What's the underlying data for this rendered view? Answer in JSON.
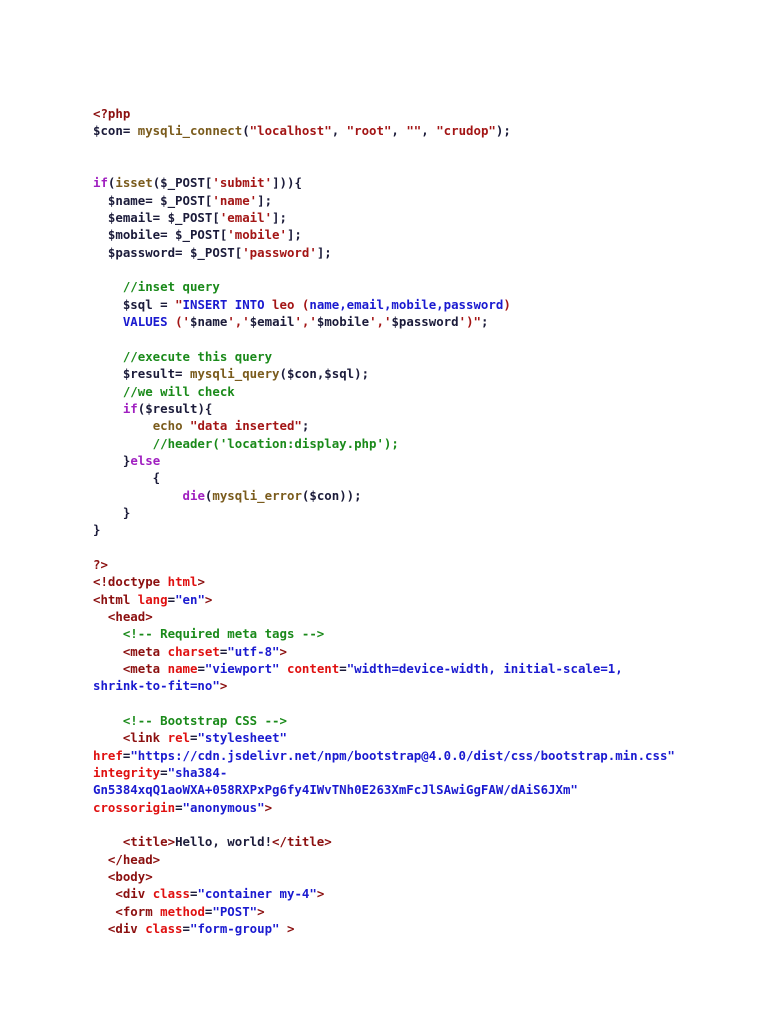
{
  "document": {
    "lines": [
      [
        {
          "text": "<?php",
          "type": "p"
        }
      ],
      [
        {
          "text": "$con= ",
          "type": "d"
        },
        {
          "text": "mysqli_connect",
          "type": "f"
        },
        {
          "text": "(",
          "type": "d"
        },
        {
          "text": "\"localhost\"",
          "type": "s"
        },
        {
          "text": ", ",
          "type": "d"
        },
        {
          "text": "\"root\"",
          "type": "s"
        },
        {
          "text": ", ",
          "type": "d"
        },
        {
          "text": "\"\"",
          "type": "s"
        },
        {
          "text": ", ",
          "type": "d"
        },
        {
          "text": "\"crudop\"",
          "type": "s"
        },
        {
          "text": ");",
          "type": "d"
        }
      ],
      [],
      [],
      [
        {
          "text": "if",
          "type": "k"
        },
        {
          "text": "(",
          "type": "d"
        },
        {
          "text": "isset",
          "type": "f"
        },
        {
          "text": "($_POST[",
          "type": "d"
        },
        {
          "text": "'submit'",
          "type": "s"
        },
        {
          "text": "])){",
          "type": "d"
        }
      ],
      [
        {
          "text": "  $name= $_POST[",
          "type": "d"
        },
        {
          "text": "'name'",
          "type": "s"
        },
        {
          "text": "];",
          "type": "d"
        }
      ],
      [
        {
          "text": "  $email= $_POST[",
          "type": "d"
        },
        {
          "text": "'email'",
          "type": "s"
        },
        {
          "text": "];",
          "type": "d"
        }
      ],
      [
        {
          "text": "  $mobile= $_POST[",
          "type": "d"
        },
        {
          "text": "'mobile'",
          "type": "s"
        },
        {
          "text": "];",
          "type": "d"
        }
      ],
      [
        {
          "text": "  $password= $_POST[",
          "type": "d"
        },
        {
          "text": "'password'",
          "type": "s"
        },
        {
          "text": "];",
          "type": "d"
        }
      ],
      [],
      [
        {
          "text": "    //inset query",
          "type": "c"
        }
      ],
      [
        {
          "text": "    $sql = ",
          "type": "d"
        },
        {
          "text": "\"",
          "type": "s"
        },
        {
          "text": "INSERT INTO",
          "type": "q"
        },
        {
          "text": " leo (",
          "type": "s"
        },
        {
          "text": "name,email,mobile,password",
          "type": "q"
        },
        {
          "text": ")",
          "type": "s"
        }
      ],
      [
        {
          "text": "    ",
          "type": "d"
        },
        {
          "text": "VALUES",
          "type": "q"
        },
        {
          "text": " ('",
          "type": "s"
        },
        {
          "text": "$name",
          "type": "d"
        },
        {
          "text": "','",
          "type": "s"
        },
        {
          "text": "$email",
          "type": "d"
        },
        {
          "text": "','",
          "type": "s"
        },
        {
          "text": "$mobile",
          "type": "d"
        },
        {
          "text": "','",
          "type": "s"
        },
        {
          "text": "$password",
          "type": "d"
        },
        {
          "text": "')\"",
          "type": "s"
        },
        {
          "text": ";",
          "type": "d"
        }
      ],
      [],
      [
        {
          "text": "    //execute this query",
          "type": "c"
        }
      ],
      [
        {
          "text": "    $result= ",
          "type": "d"
        },
        {
          "text": "mysqli_query",
          "type": "f"
        },
        {
          "text": "($con,$sql);",
          "type": "d"
        }
      ],
      [
        {
          "text": "    //we will check",
          "type": "c"
        }
      ],
      [
        {
          "text": "    ",
          "type": "d"
        },
        {
          "text": "if",
          "type": "k"
        },
        {
          "text": "($result){",
          "type": "d"
        }
      ],
      [
        {
          "text": "        ",
          "type": "d"
        },
        {
          "text": "echo",
          "type": "f"
        },
        {
          "text": " \"data inserted\"",
          "type": "s"
        },
        {
          "text": ";",
          "type": "d"
        }
      ],
      [
        {
          "text": "        //header('location:display.php');",
          "type": "c"
        }
      ],
      [
        {
          "text": "    }",
          "type": "d"
        },
        {
          "text": "else",
          "type": "k"
        }
      ],
      [
        {
          "text": "        {",
          "type": "d"
        }
      ],
      [
        {
          "text": "            ",
          "type": "d"
        },
        {
          "text": "die",
          "type": "k"
        },
        {
          "text": "(",
          "type": "d"
        },
        {
          "text": "mysqli_error",
          "type": "f"
        },
        {
          "text": "($con));",
          "type": "d"
        }
      ],
      [
        {
          "text": "    }",
          "type": "d"
        }
      ],
      [
        {
          "text": "}",
          "type": "d"
        }
      ],
      [],
      [
        {
          "text": "?>",
          "type": "p"
        }
      ],
      [
        {
          "text": "<!doctype ",
          "type": "t"
        },
        {
          "text": "html",
          "type": "a"
        },
        {
          "text": ">",
          "type": "t"
        }
      ],
      [
        {
          "text": "<html ",
          "type": "t"
        },
        {
          "text": "lang",
          "type": "a"
        },
        {
          "text": "=",
          "type": "d"
        },
        {
          "text": "\"en\"",
          "type": "v"
        },
        {
          "text": ">",
          "type": "t"
        }
      ],
      [
        {
          "text": "  <head>",
          "type": "t"
        }
      ],
      [
        {
          "text": "    <!-- Required meta tags -->",
          "type": "c"
        }
      ],
      [
        {
          "text": "    <meta ",
          "type": "t"
        },
        {
          "text": "charset",
          "type": "a"
        },
        {
          "text": "=",
          "type": "d"
        },
        {
          "text": "\"utf-8\"",
          "type": "v"
        },
        {
          "text": ">",
          "type": "t"
        }
      ],
      [
        {
          "text": "    <meta ",
          "type": "t"
        },
        {
          "text": "name",
          "type": "a"
        },
        {
          "text": "=",
          "type": "d"
        },
        {
          "text": "\"viewport\"",
          "type": "v"
        },
        {
          "text": " ",
          "type": "d"
        },
        {
          "text": "content",
          "type": "a"
        },
        {
          "text": "=",
          "type": "d"
        },
        {
          "text": "\"width=device-width, initial-scale=1,",
          "type": "v"
        }
      ],
      [
        {
          "text": "shrink-to-fit=no\"",
          "type": "v"
        },
        {
          "text": ">",
          "type": "t"
        }
      ],
      [],
      [
        {
          "text": "    <!-- Bootstrap CSS -->",
          "type": "c"
        }
      ],
      [
        {
          "text": "    <link ",
          "type": "t"
        },
        {
          "text": "rel",
          "type": "a"
        },
        {
          "text": "=",
          "type": "d"
        },
        {
          "text": "\"stylesheet\"",
          "type": "v"
        }
      ],
      [
        {
          "text": "href",
          "type": "a"
        },
        {
          "text": "=",
          "type": "d"
        },
        {
          "text": "\"https://cdn.jsdelivr.net/npm/bootstrap@4.0.0/dist/css/bootstrap.min.css\"",
          "type": "v"
        }
      ],
      [
        {
          "text": "integrity",
          "type": "a"
        },
        {
          "text": "=",
          "type": "d"
        },
        {
          "text": "\"sha384-",
          "type": "v"
        }
      ],
      [
        {
          "text": "Gn5384xqQ1aoWXA+058RXPxPg6fy4IWvTNh0E263XmFcJlSAwiGgFAW/dAiS6JXm\"",
          "type": "v"
        }
      ],
      [
        {
          "text": "crossorigin",
          "type": "a"
        },
        {
          "text": "=",
          "type": "d"
        },
        {
          "text": "\"anonymous\"",
          "type": "v"
        },
        {
          "text": ">",
          "type": "t"
        }
      ],
      [],
      [
        {
          "text": "    <title>",
          "type": "t"
        },
        {
          "text": "Hello, world!",
          "type": "d"
        },
        {
          "text": "</title>",
          "type": "t"
        }
      ],
      [
        {
          "text": "  </head>",
          "type": "t"
        }
      ],
      [
        {
          "text": "  <body>",
          "type": "t"
        }
      ],
      [
        {
          "text": "   <div ",
          "type": "t"
        },
        {
          "text": "class",
          "type": "a"
        },
        {
          "text": "=",
          "type": "d"
        },
        {
          "text": "\"container my-4\"",
          "type": "v"
        },
        {
          "text": ">",
          "type": "t"
        }
      ],
      [
        {
          "text": "   <form ",
          "type": "t"
        },
        {
          "text": "method",
          "type": "a"
        },
        {
          "text": "=",
          "type": "d"
        },
        {
          "text": "\"POST\"",
          "type": "v"
        },
        {
          "text": ">",
          "type": "t"
        }
      ],
      [
        {
          "text": "  <div ",
          "type": "t"
        },
        {
          "text": "class",
          "type": "a"
        },
        {
          "text": "=",
          "type": "d"
        },
        {
          "text": "\"form-group\"",
          "type": "v"
        },
        {
          "text": " >",
          "type": "t"
        }
      ]
    ]
  }
}
